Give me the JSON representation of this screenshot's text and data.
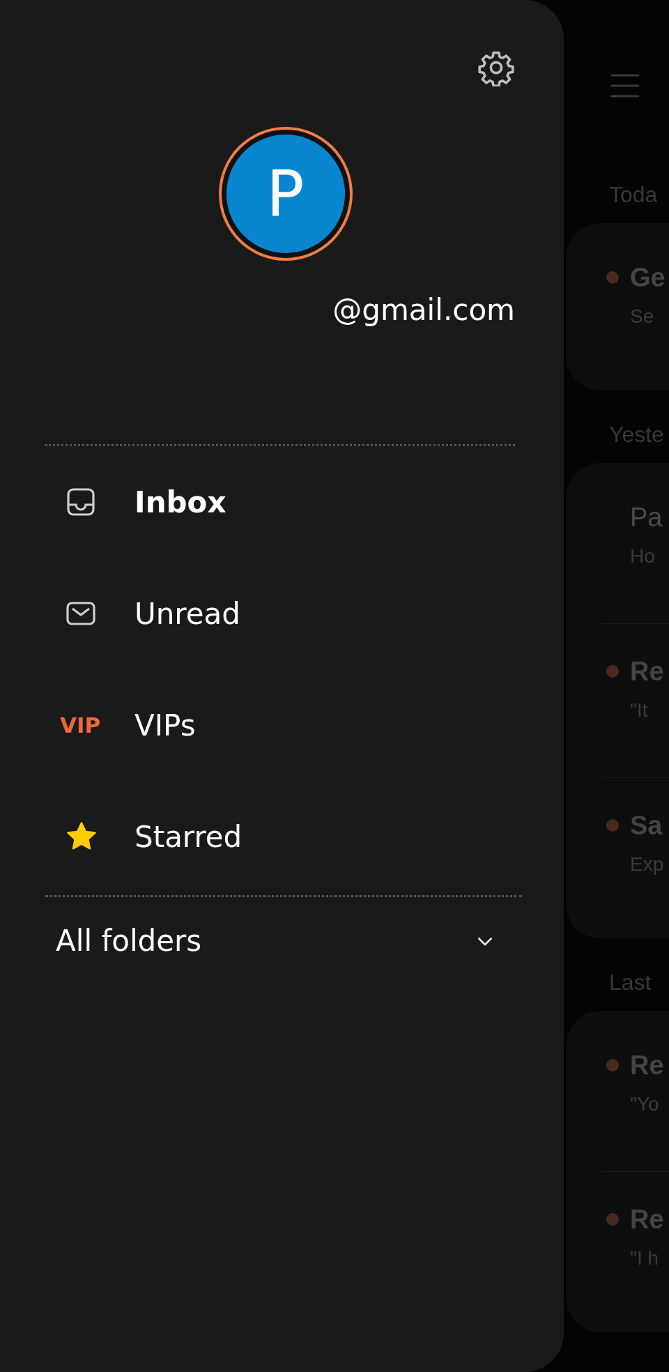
{
  "drawer": {
    "account": {
      "avatar_letter": "P",
      "email": "@gmail.com"
    },
    "items": [
      {
        "kind": "inbox",
        "label": "Inbox",
        "selected": true
      },
      {
        "kind": "unread",
        "label": "Unread",
        "selected": false
      },
      {
        "kind": "vip",
        "badge": "VIP",
        "label": "VIPs",
        "selected": false
      },
      {
        "kind": "starred",
        "label": "Starred",
        "selected": false
      }
    ],
    "all_folders": {
      "label": "All folders",
      "expanded": false
    }
  },
  "mail_list": {
    "sections": [
      {
        "heading": "Toda",
        "emails": [
          {
            "sender": "Ge",
            "preview": "Se",
            "unread": true
          }
        ]
      },
      {
        "heading": "Yeste",
        "emails": [
          {
            "sender": "Pa",
            "preview": "Ho",
            "unread": false
          },
          {
            "sender": "Re",
            "preview": "\"It",
            "unread": true
          },
          {
            "sender": "Sa",
            "preview": "Exp",
            "unread": true
          }
        ]
      },
      {
        "heading": "Last",
        "emails": [
          {
            "sender": "Re",
            "preview": "\"Yo",
            "unread": true
          },
          {
            "sender": "Re",
            "preview": "\"I h",
            "unread": true
          }
        ]
      }
    ]
  }
}
